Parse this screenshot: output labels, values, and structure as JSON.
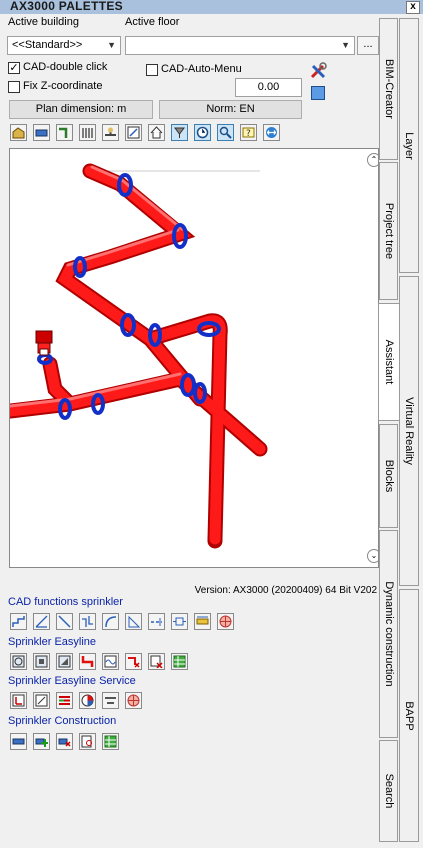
{
  "window": {
    "title": "AX3000 PALETTES",
    "close": "x"
  },
  "building": {
    "label": "Active building",
    "value": "<<Standard>>"
  },
  "floor": {
    "label": "Active floor",
    "value": "",
    "more": "..."
  },
  "options": {
    "cad_double_click": {
      "label": "CAD-double click",
      "checked": true
    },
    "cad_auto_menu": {
      "label": "CAD-Auto-Menu",
      "checked": false
    },
    "fix_z": {
      "label": "Fix Z-coordinate",
      "checked": false
    },
    "z_value": "0.00"
  },
  "buttons": {
    "plan_dimension": "Plan dimension: m",
    "norm": "Norm: EN"
  },
  "toolbar_icons": [
    "building-icon",
    "beam-icon",
    "pipe-fitting-icon",
    "radiator-icon",
    "valve-icon",
    "drawing-icon",
    "house-icon",
    "sprinkler-icon",
    "clock-icon",
    "zoom-icon",
    "help-icon",
    "arrows-icon"
  ],
  "version": "Version: AX3000 (20200409) 64 Bit V202",
  "sections": [
    {
      "title": "CAD functions sprinkler",
      "icons": [
        "step-line-icon",
        "diagonal-icon",
        "line-icon",
        "offset-icon",
        "arc-icon",
        "angle-icon",
        "dash-line-icon",
        "connect-icon",
        "measure-icon",
        "globe-icon"
      ]
    },
    {
      "title": "Sprinkler Easyline",
      "icons": [
        "nozzle-icon",
        "square-nozzle-icon",
        "corner-icon",
        "red-pipe-icon",
        "wave-icon",
        "delete-pipe-icon",
        "delete-list-icon",
        "table-icon"
      ]
    },
    {
      "title": "Sprinkler Easyline Service",
      "icons": [
        "head-icon",
        "frame-icon",
        "legend-icon",
        "chart-icon",
        "pipe-flow-icon",
        "network-icon"
      ]
    },
    {
      "title": "Sprinkler Construction",
      "icons": [
        "segment-icon",
        "add-segment-icon",
        "remove-segment-icon",
        "search-doc-icon",
        "grid-table-icon"
      ]
    }
  ],
  "tabs_inner": [
    "BIM-Creator",
    "Project tree",
    "Assistant",
    "Blocks",
    "Dynamic construction",
    "Search"
  ],
  "tabs_outer": [
    "Layer",
    "Virtual Reality",
    "BAPP"
  ],
  "active_tab": "Assistant"
}
